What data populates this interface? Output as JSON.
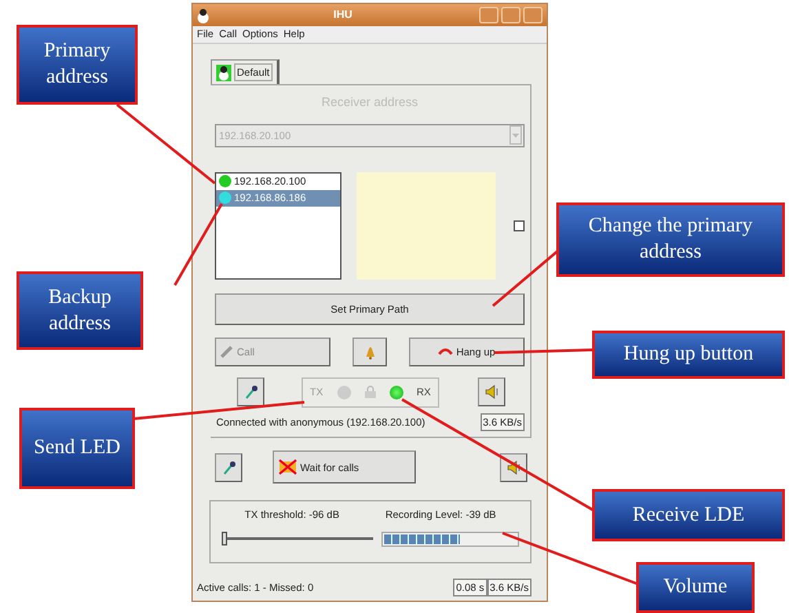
{
  "window": {
    "title": "IHU"
  },
  "menu": [
    "File",
    "Call",
    "Options",
    "Help"
  ],
  "tabs": [
    {
      "label": "Default",
      "selected": true
    }
  ],
  "receiver_label": "Receiver address",
  "address_combo": {
    "value": "192.168.20.100",
    "disabled": true
  },
  "paths": [
    {
      "address": "192.168.20.100",
      "color": "#22cc22",
      "selected": false
    },
    {
      "address": "192.168.86.186",
      "color": "#33dddd",
      "selected": true
    }
  ],
  "path_checkbox": {
    "checked": false
  },
  "set_primary_button": "Set Primary Path",
  "call_button": {
    "label": "Call",
    "disabled": true
  },
  "hangup_button": {
    "label": "Hang up",
    "disabled": false
  },
  "leds": [
    {
      "label": "TX",
      "on": false
    },
    {
      "label": "RX",
      "on": true
    }
  ],
  "connection_status": "Connected with anonymous (192.168.20.100)",
  "connection_rate": "3.6 KB/s",
  "wait_button": "Wait for calls",
  "tx_threshold": {
    "label": "TX threshold: -96 dB",
    "level": 0.0
  },
  "recording": {
    "label": "Recording Level: -39 dB",
    "level": 0.57
  },
  "status_bar": {
    "calls": "Active calls: 1 - Missed: 0",
    "latency": "0.08 s",
    "rate": "3.6 KB/s"
  },
  "annotations": [
    "Primary address",
    "Backup address",
    "Change the primary address",
    "Hung up button",
    "Send LED",
    "Receive LDE",
    "Volume"
  ]
}
